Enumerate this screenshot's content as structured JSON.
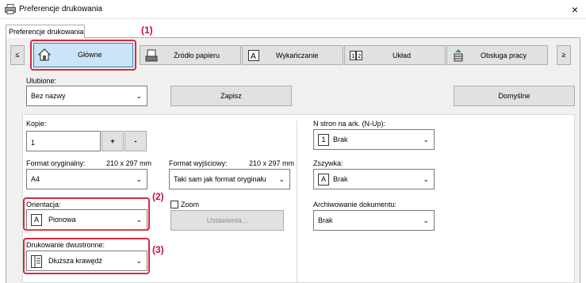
{
  "window": {
    "title": "Preferencje drukowania",
    "close_glyph": "×"
  },
  "tab": {
    "label": "Preferencje drukowania"
  },
  "callouts": {
    "c1": "(1)",
    "c2": "(2)",
    "c3": "(3)"
  },
  "toolbar": {
    "nav_prev": "≤",
    "nav_next": "≥",
    "buttons": [
      {
        "label": "Główne",
        "icon": "home-icon"
      },
      {
        "label": "Źródło papieru",
        "icon": "paper-tray-icon"
      },
      {
        "label": "Wykańczanie",
        "icon": "finishing-icon"
      },
      {
        "label": "Układ",
        "icon": "layout-icon"
      },
      {
        "label": "Obsługa pracy",
        "icon": "job-handling-icon"
      }
    ]
  },
  "favorites": {
    "label": "Ulubione:",
    "value": "Bez nazwy",
    "save_button": "Zapisz",
    "default_button": "Domyślne"
  },
  "copies": {
    "label": "Kopie:",
    "value": "1",
    "plus": "+",
    "minus": "-"
  },
  "original_format": {
    "label": "Format oryginalny:",
    "size": "210 x 297 mm",
    "value": "A4"
  },
  "output_format": {
    "label": "Format wyjściowy:",
    "size": "210 x 297 mm",
    "value": "Taki sam jak format oryginału"
  },
  "orientation": {
    "label": "Orientacja:",
    "value": "Pionowa",
    "icon_text": "A"
  },
  "zoom": {
    "label": "Zoom",
    "settings_button": "Ustawienia..."
  },
  "duplex": {
    "label": "Drukowanie dwustronne:",
    "value": "Dłuższa krawędź"
  },
  "nup": {
    "label": "N stron na ark. (N-Up):",
    "value": "Brak",
    "icon_text": "1"
  },
  "staple": {
    "label": "Zszywka:",
    "value": "Brak",
    "icon_text": "A"
  },
  "archive": {
    "label": "Archiwowanie dokumentu:",
    "value": "Brak"
  },
  "colors": {
    "accent_red": "#d32a3f",
    "selected_bg": "#cce4f7"
  }
}
